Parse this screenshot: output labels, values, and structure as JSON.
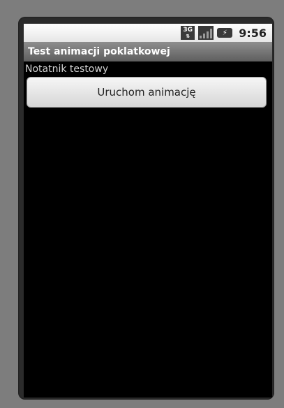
{
  "status_bar": {
    "network_label": "3G",
    "network_arrows": "⇅",
    "battery_symbol": "⚡",
    "time": "9:56"
  },
  "app": {
    "title": "Test animacji poklatkowej",
    "note_label": "Notatnik testowy",
    "start_button_label": "Uruchom animację"
  }
}
